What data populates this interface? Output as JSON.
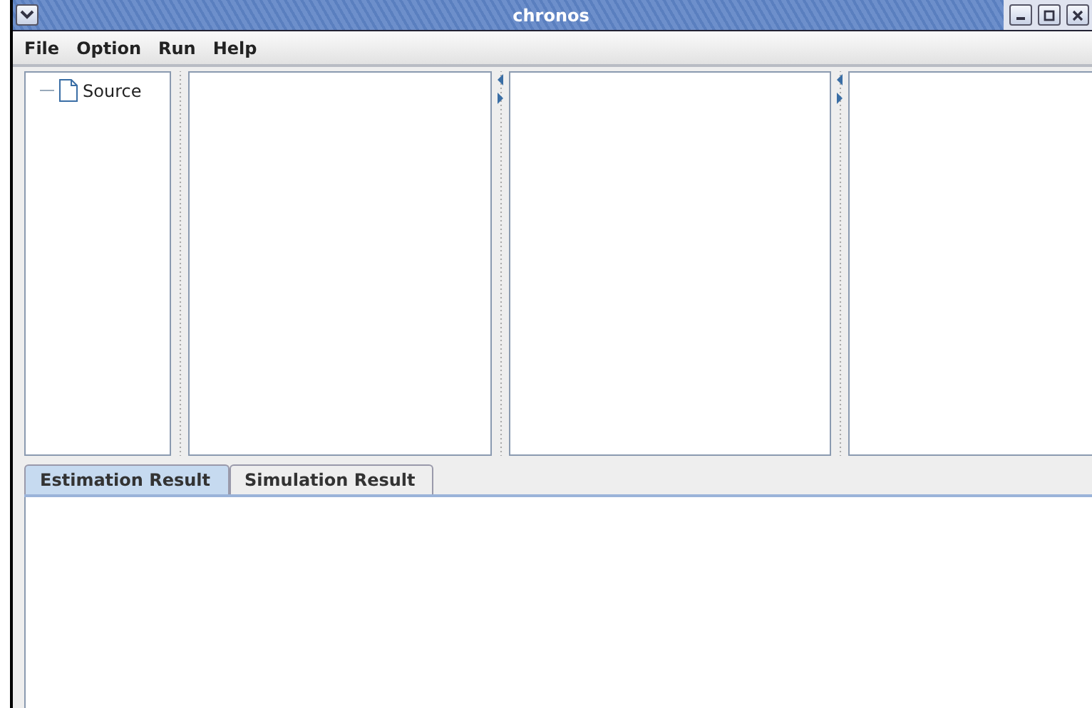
{
  "window": {
    "title": "chronos"
  },
  "menu": [
    "File",
    "Option",
    "Run",
    "Help"
  ],
  "tree": {
    "items": [
      {
        "label": "Source"
      }
    ]
  },
  "tabs": [
    {
      "label": "Estimation Result",
      "selected": true
    },
    {
      "label": "Simulation Result",
      "selected": false
    }
  ]
}
